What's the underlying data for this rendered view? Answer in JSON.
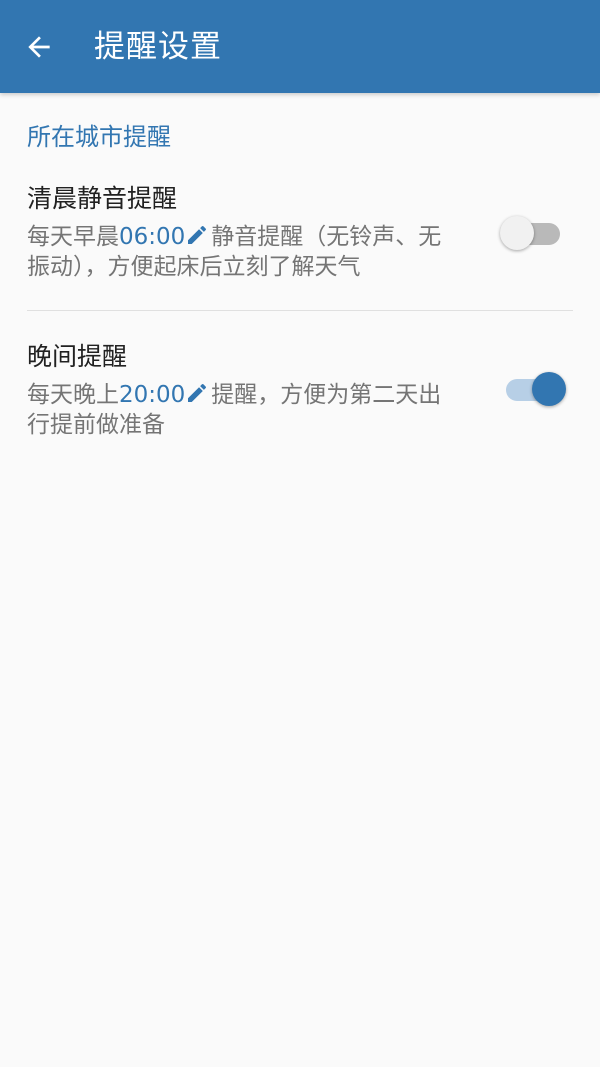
{
  "header": {
    "title": "提醒设置",
    "back_icon": "arrow-left-icon",
    "background_color": "#3276b1"
  },
  "section": {
    "title": "所在城市提醒"
  },
  "settings": [
    {
      "title": "清晨静音提醒",
      "desc_prefix": "每天早晨",
      "time": "06:00",
      "desc_suffix": "静音提醒（无铃声、无振动），方便起床后立刻了解天气",
      "enabled": false,
      "edit_icon": "pencil-icon"
    },
    {
      "title": "晚间提醒",
      "desc_prefix": "每天晚上",
      "time": "20:00",
      "desc_suffix": "提醒，方便为第二天出行提前做准备",
      "enabled": true,
      "edit_icon": "pencil-icon"
    }
  ],
  "colors": {
    "accent": "#3276b1",
    "toggle_on_track": "#b7cfe6",
    "toggle_off_track": "#b9b9b9",
    "secondary_text": "#757575"
  }
}
